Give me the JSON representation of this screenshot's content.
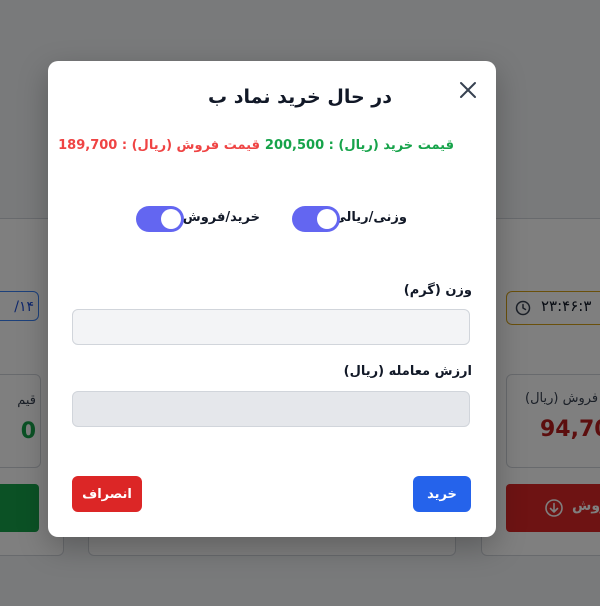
{
  "background": {
    "left_card": {
      "date_partial": "/۱۴",
      "sell_label_partial": "قیم",
      "sell_value_partial": "0",
      "button_color": "#16a34a"
    },
    "right_card": {
      "timer": "۲۳:۴۶:۳",
      "sell_label": "فروش (ریال)",
      "sell_value": "94,70",
      "button_label": "روش",
      "button_color": "#dc2626"
    }
  },
  "modal": {
    "title": "در حال خرید نماد ب",
    "close_icon": "close-icon",
    "buy_price": "قیمت خرید (ریال) : 200,500",
    "sell_price": "قیمت فروش (ریال) : 189,700",
    "buy_color": "#16a34a",
    "sell_color": "#ef4444",
    "toggles": [
      {
        "label": "وزنی/ریالی",
        "on": true
      },
      {
        "label": "خرید/فروش",
        "on": true
      }
    ],
    "toggle_color": "#6366f1",
    "weight_label": "وزن (گرم)",
    "weight_value": "",
    "amount_label": "ارزش معامله (ریال)",
    "amount_value": "",
    "buy_button": "خرید",
    "cancel_button": "انصراف",
    "buy_button_color": "#2563eb",
    "cancel_button_color": "#dc2626"
  }
}
